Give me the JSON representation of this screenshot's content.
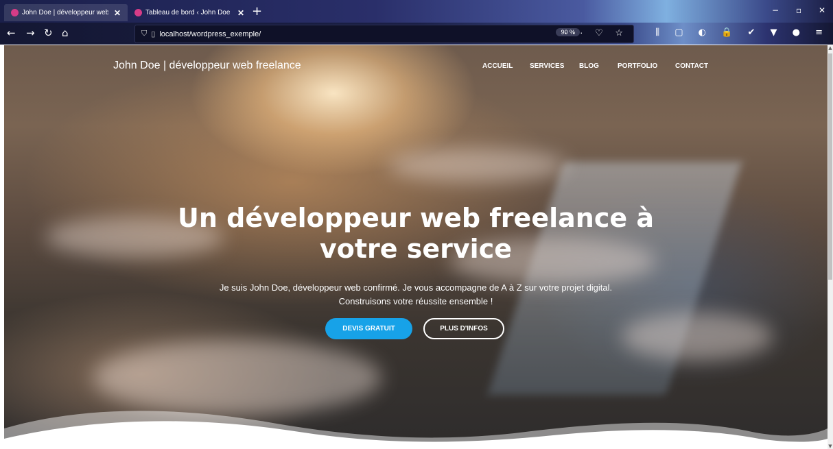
{
  "browser": {
    "tabs": [
      {
        "title": "John Doe | développeur web fr",
        "close": "✕"
      },
      {
        "title": "Tableau de bord ‹ John Doe | dé",
        "close": "✕"
      }
    ],
    "new_tab": "+",
    "url": "localhost/wordpress_exemple/",
    "zoom": "90 %",
    "url_icons": "··· ♡ ☆",
    "toolbar_icons": "⫼ ▢ ◐ 🔒 ✔ ▼ ● ≡",
    "window": {
      "minimize": "−",
      "maximize": "▫",
      "close": "✕"
    },
    "nav": {
      "back": "←",
      "forward": "→",
      "reload": "↻",
      "home": "⌂"
    }
  },
  "site": {
    "title": "John Doe | développeur web freelance",
    "menu": [
      "ACCUEIL",
      "SERVICES",
      "BLOG",
      "PORTFOLIO",
      "CONTACT"
    ]
  },
  "hero": {
    "title_line1": "Un développeur web freelance à",
    "title_line2": "votre service",
    "subtitle_line1": "Je suis John Doe, développeur web confirmé. Je vous accompagne de A à Z sur votre projet digital.",
    "subtitle_line2": "Construisons votre réussite ensemble !",
    "cta_primary": "DEVIS GRATUIT",
    "cta_secondary": "PLUS D'INFOS"
  },
  "colors": {
    "accent": "#17a2e8",
    "text": "#ffffff"
  }
}
